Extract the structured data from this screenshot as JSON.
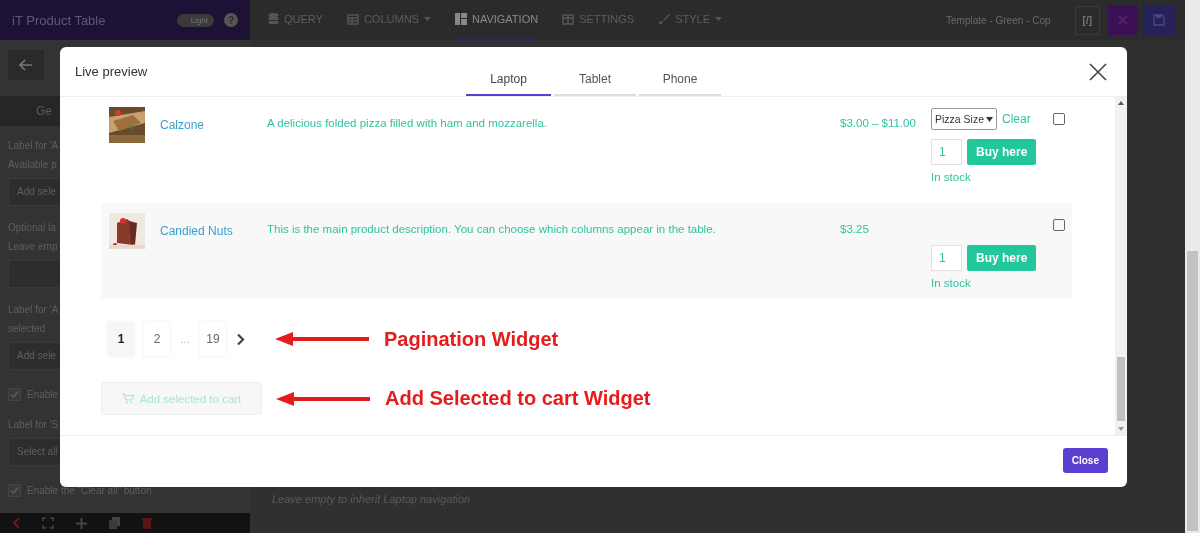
{
  "editor": {
    "app_title": "iT Product Table",
    "theme_toggle": {
      "label": "Light",
      "on": false
    },
    "help_label": "?",
    "tabs": [
      {
        "label": "QUERY",
        "selected": false,
        "has_menu": false
      },
      {
        "label": "COLUMNS",
        "selected": false,
        "has_menu": true
      },
      {
        "label": "NAVIGATION",
        "selected": true,
        "has_menu": false
      },
      {
        "label": "SETTINGS",
        "selected": false,
        "has_menu": false
      },
      {
        "label": "STYLE",
        "selected": false,
        "has_menu": true
      }
    ],
    "template_name": "Template - Green - Cop",
    "code_button": "[/]",
    "sidebar": {
      "items": [
        {
          "kind": "button",
          "text": "Ge"
        },
        {
          "kind": "label",
          "text": "Label for 'A"
        },
        {
          "kind": "label",
          "text": "Available p"
        },
        {
          "kind": "field",
          "value": "Add sele"
        },
        {
          "kind": "label",
          "text": "Optional la"
        },
        {
          "kind": "label",
          "text": "Leave emp"
        },
        {
          "kind": "field"
        },
        {
          "kind": "label",
          "text": "Label for 'A"
        },
        {
          "kind": "label",
          "text": "selected"
        },
        {
          "kind": "field",
          "value": "Add sele"
        },
        {
          "kind": "checkbox",
          "text": "Enable",
          "checked": true
        },
        {
          "kind": "label",
          "text": "Label for 'S"
        },
        {
          "kind": "field",
          "value": "Select all"
        },
        {
          "kind": "checkbox",
          "text": "Enable the “Clear all” button",
          "checked": true
        }
      ]
    },
    "main_hint": "Leave empty to inherit Laptop navigation"
  },
  "modal": {
    "title": "Live preview",
    "tabs": [
      {
        "label": "Laptop",
        "selected": true
      },
      {
        "label": "Tablet",
        "selected": false
      },
      {
        "label": "Phone",
        "selected": false
      }
    ],
    "close_label": "Close"
  },
  "products": [
    {
      "name": "Calzone",
      "description": "A delicious folded pizza filled with ham and mozzarella.",
      "price": "$3.00 – $11.00",
      "variation": {
        "select_label": "Pizza Size",
        "clear_label": "Clear"
      },
      "quantity": "1",
      "buy_label": "Buy here",
      "stock": "In stock",
      "checked": false
    },
    {
      "name": "Candied Nuts",
      "description": "This is the main product description. You can choose which columns appear in the table.",
      "price": "$3.25",
      "quantity": "1",
      "buy_label": "Buy here",
      "stock": "In stock",
      "checked": false
    }
  ],
  "pagination": {
    "pages": [
      {
        "kind": "page",
        "label": "1",
        "selected": true
      },
      {
        "kind": "page",
        "label": "2",
        "selected": false
      },
      {
        "kind": "ellipsis",
        "label": "…"
      },
      {
        "kind": "page",
        "label": "19",
        "selected": false
      }
    ]
  },
  "add_to_cart": {
    "label": "Add selected to cart",
    "disabled": true
  },
  "annotations": [
    {
      "text": "Pagination Widget"
    },
    {
      "text": "Add Selected to cart Widget"
    }
  ]
}
